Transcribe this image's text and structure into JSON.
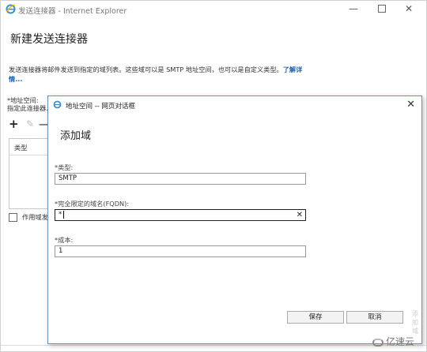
{
  "window": {
    "title": "发送连接器 - Internet Explorer",
    "minimize_glyph": "—",
    "close_glyph": "✕"
  },
  "page": {
    "title": "新建发送连接器",
    "description": "发送连接器将邮件发送到指定的域列表。这些域可以是 SMTP 地址空间，也可以是自定义类型。",
    "learn_more": "了解详情...",
    "address_space_label": "*地址空间:",
    "address_space_hint": "指定此连接器...",
    "toolbar": {
      "add": "+",
      "edit": "✎",
      "remove": "—"
    },
    "table_header": "类型",
    "scope_label": "作用域发..."
  },
  "dialog": {
    "title": "地址空间 -- 网页对话框",
    "close_glyph": "✕",
    "heading": "添加域",
    "type_label": "*类型:",
    "type_value": "SMTP",
    "fqdn_label": "*完全限定的域名(FQDN):",
    "fqdn_value": "*",
    "fqdn_clear": "✕",
    "cost_label": "*成本:",
    "cost_value": "1",
    "save_label": "保存",
    "cancel_label": "取消",
    "side_text": "添 加 域"
  },
  "watermark": {
    "text": "亿速云"
  },
  "colors": {
    "link": "#1a5fb4",
    "dialog_border": "#6a8fc4"
  }
}
